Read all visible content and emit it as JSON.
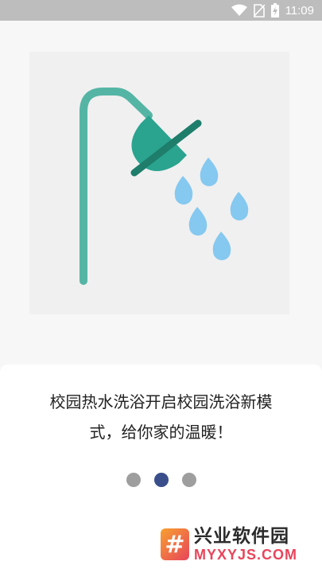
{
  "status_bar": {
    "time": "11:09"
  },
  "intro": {
    "slogan_line1": "校园热水洗浴开启校园洗浴新模",
    "slogan_line2": "式，给你家的温暖！",
    "page_count": 3,
    "active_page": 2
  },
  "watermark": {
    "logo_glyph": "#",
    "title": "兴业软件园",
    "subtitle": "MYXYJS.COM"
  },
  "colors": {
    "shower_pipe": "#55b5a5",
    "shower_head": "#2aa38f",
    "water_drop": "#85c8f0",
    "dot_active": "#3a4e8c",
    "dot_inactive": "#9e9e9e"
  }
}
